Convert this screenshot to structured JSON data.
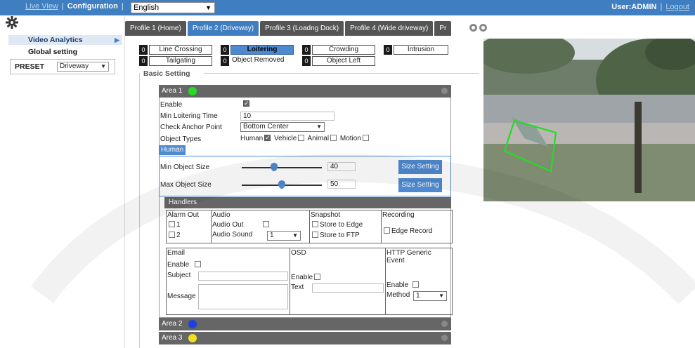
{
  "topbar": {
    "live_view": "Live View",
    "separator": "|",
    "configuration": "Configuration",
    "language": "English",
    "user": "User:ADMIN",
    "logout": "Logout"
  },
  "sidebar": {
    "video_analytics": "Video Analytics",
    "global_setting": "Global setting",
    "preset_label": "PRESET",
    "preset_value": "Driveway"
  },
  "tabs": [
    "Profile 1  (Home)",
    "Profile 2  (Driveway)",
    "Profile 3  (Loadng Dock)",
    "Profile 4  (Wide driveway)",
    "Pr"
  ],
  "detections": [
    {
      "count": "0",
      "name": "Line Crossing"
    },
    {
      "count": "0",
      "name": "Loitering"
    },
    {
      "count": "0",
      "name": "Crowding"
    },
    {
      "count": "0",
      "name": "Intrusion"
    },
    {
      "count": "0",
      "name": "Tailgating"
    },
    {
      "count": "0",
      "name": "Object Removed"
    },
    {
      "count": "0",
      "name": "Object Left"
    }
  ],
  "basic_setting": "Basic Setting",
  "area1": {
    "title": "Area 1",
    "color": "#22dd22",
    "enable_label": "Enable",
    "min_loitering_label": "Min Loitering Time",
    "min_loitering_value": "10",
    "anchor_label": "Check Anchor Point",
    "anchor_value": "Bottom Center",
    "object_types_label": "Object Types",
    "types": {
      "human": "Human",
      "vehicle": "Vehicle",
      "animal": "Animal",
      "motion": "Motion"
    },
    "human_tab": "Human",
    "min_size_label": "Min Object Size",
    "min_size_value": "40",
    "max_size_label": "Max Object Size",
    "max_size_value": "50",
    "size_setting": "Size Setting",
    "slider_min_fraction": 0.4,
    "slider_max_fraction": 0.5
  },
  "handlers": {
    "title": "Handlers",
    "alarm_out": "Alarm Out",
    "alarm_1": "1",
    "alarm_2": "2",
    "audio": "Audio",
    "audio_out": "Audio Out",
    "audio_sound": "Audio Sound",
    "audio_sound_value": "1",
    "snapshot": "Snapshot",
    "store_edge": "Store to Edge",
    "store_ftp": "Store to FTP",
    "recording": "Recording",
    "edge_record": "Edge Record",
    "email": "Email",
    "email_enable": "Enable",
    "subject": "Subject",
    "message": "Message",
    "osd": "OSD",
    "osd_enable": "Enable",
    "osd_text": "Text",
    "http": "HTTP Generic Event",
    "http_enable": "Enable",
    "method": "Method",
    "method_value": "1"
  },
  "area2": {
    "title": "Area 2",
    "color": "#1f3fe0"
  },
  "area3": {
    "title": "Area 3",
    "color": "#f0e020"
  }
}
